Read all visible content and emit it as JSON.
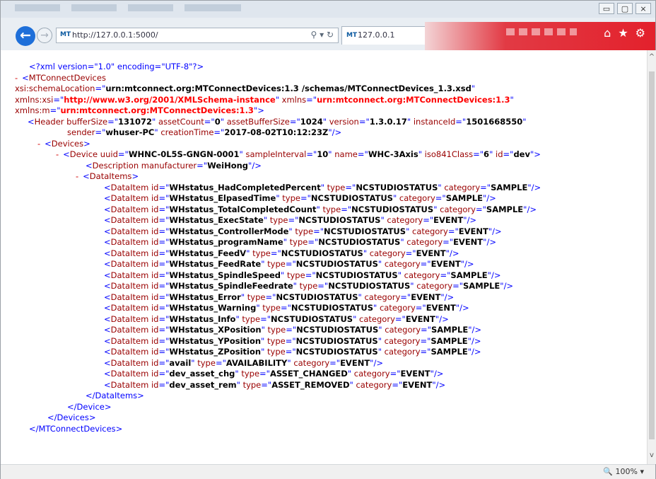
{
  "window": {
    "minimize_glyph": "▭",
    "maximize_glyph": "▢",
    "close_glyph": "⨯"
  },
  "nav": {
    "back_glyph": "←",
    "forward_glyph": "→",
    "favicon_text": "MT",
    "url": "http://127.0.0.1:5000/",
    "address_icons": "⚲ ▾ ↻",
    "tab_favicon": "MT",
    "tab_title": "127.0.0.1",
    "tab_close": "×",
    "toolbar_icons": [
      "⌂",
      "★",
      "⚙"
    ]
  },
  "xml": {
    "pi": "<?xml version=\"1.0\" encoding=\"UTF-8\"?>",
    "root_open": {
      "toggle": "-",
      "tag": "MTConnectDevices",
      "attr_lines": [
        {
          "name": "xsi:schemaLocation",
          "value": "urn:mtconnect.org:MTConnectDevices:1.3 /schemas/MTConnectDevices_1.3.xsd"
        },
        {
          "name1": "xmlns:xsi",
          "value1": "http://www.w3.org/2001/XMLSchema-instance",
          "name2": "xmlns",
          "value2": "urn:mtconnect.org:MTConnectDevices:1.3"
        },
        {
          "name": "xmlns:m",
          "value": "urn:mtconnect.org:MTConnectDevices:1.3"
        }
      ]
    },
    "header": {
      "tag": "Header",
      "line1": [
        {
          "n": "bufferSize",
          "v": "131072"
        },
        {
          "n": "assetCount",
          "v": "0"
        },
        {
          "n": "assetBufferSize",
          "v": "1024"
        },
        {
          "n": "version",
          "v": "1.3.0.17"
        },
        {
          "n": "instanceId",
          "v": "1501668550"
        }
      ],
      "line2": [
        {
          "n": "sender",
          "v": "whuser-PC"
        },
        {
          "n": "creationTime",
          "v": "2017-08-02T10:12:23Z"
        }
      ]
    },
    "devices_tag": "Devices",
    "device": {
      "tag": "Device",
      "attrs": [
        {
          "n": "uuid",
          "v": "WHNC-0L5S-GNGN-0001"
        },
        {
          "n": "sampleInterval",
          "v": "10"
        },
        {
          "n": "name",
          "v": "WHC-3Axis"
        },
        {
          "n": "iso841Class",
          "v": "6"
        },
        {
          "n": "id",
          "v": "dev"
        }
      ]
    },
    "description": {
      "tag": "Description",
      "attr": "manufacturer",
      "value": "WeiHong"
    },
    "dataitems_tag": "DataItems",
    "dataitems": [
      {
        "id": "WHstatus_HadCompletedPercent",
        "type": "NCSTUDIOSTATUS",
        "category": "SAMPLE"
      },
      {
        "id": "WHstatus_ElpasedTime",
        "type": "NCSTUDIOSTATUS",
        "category": "SAMPLE"
      },
      {
        "id": "WHstatus_TotalCompletedCount",
        "type": "NCSTUDIOSTATUS",
        "category": "SAMPLE"
      },
      {
        "id": "WHstatus_ExecState",
        "type": "NCSTUDIOSTATUS",
        "category": "EVENT"
      },
      {
        "id": "WHstatus_ControllerMode",
        "type": "NCSTUDIOSTATUS",
        "category": "EVENT"
      },
      {
        "id": "WHstatus_programName",
        "type": "NCSTUDIOSTATUS",
        "category": "EVENT"
      },
      {
        "id": "WHstatus_FeedV",
        "type": "NCSTUDIOSTATUS",
        "category": "EVENT"
      },
      {
        "id": "WHstatus_FeedRate",
        "type": "NCSTUDIOSTATUS",
        "category": "EVENT"
      },
      {
        "id": "WHstatus_SpindleSpeed",
        "type": "NCSTUDIOSTATUS",
        "category": "SAMPLE"
      },
      {
        "id": "WHstatus_SpindleFeedrate",
        "type": "NCSTUDIOSTATUS",
        "category": "SAMPLE"
      },
      {
        "id": "WHstatus_Error",
        "type": "NCSTUDIOSTATUS",
        "category": "EVENT"
      },
      {
        "id": "WHstatus_Warning",
        "type": "NCSTUDIOSTATUS",
        "category": "EVENT"
      },
      {
        "id": "WHstatus_Info",
        "type": "NCSTUDIOSTATUS",
        "category": "EVENT"
      },
      {
        "id": "WHstatus_XPosition",
        "type": "NCSTUDIOSTATUS",
        "category": "SAMPLE"
      },
      {
        "id": "WHstatus_YPosition",
        "type": "NCSTUDIOSTATUS",
        "category": "SAMPLE"
      },
      {
        "id": "WHstatus_ZPosition",
        "type": "NCSTUDIOSTATUS",
        "category": "SAMPLE"
      },
      {
        "id": "avail",
        "type": "AVAILABILITY",
        "category": "EVENT"
      },
      {
        "id": "dev_asset_chg",
        "type": "ASSET_CHANGED",
        "category": "EVENT"
      },
      {
        "id": "dev_asset_rem",
        "type": "ASSET_REMOVED",
        "category": "EVENT"
      }
    ],
    "dataitems_close": "</DataItems>",
    "device_close": "</Device>",
    "devices_close": "</Devices>",
    "root_close": "</MTConnectDevices>"
  },
  "status": {
    "zoom": "🔍 100%  ▾"
  },
  "colors": {
    "tag": "#990000",
    "bracket": "#0000ff",
    "value": "#000000",
    "namespace_value": "#ff0000",
    "toggle": "#d20000"
  }
}
